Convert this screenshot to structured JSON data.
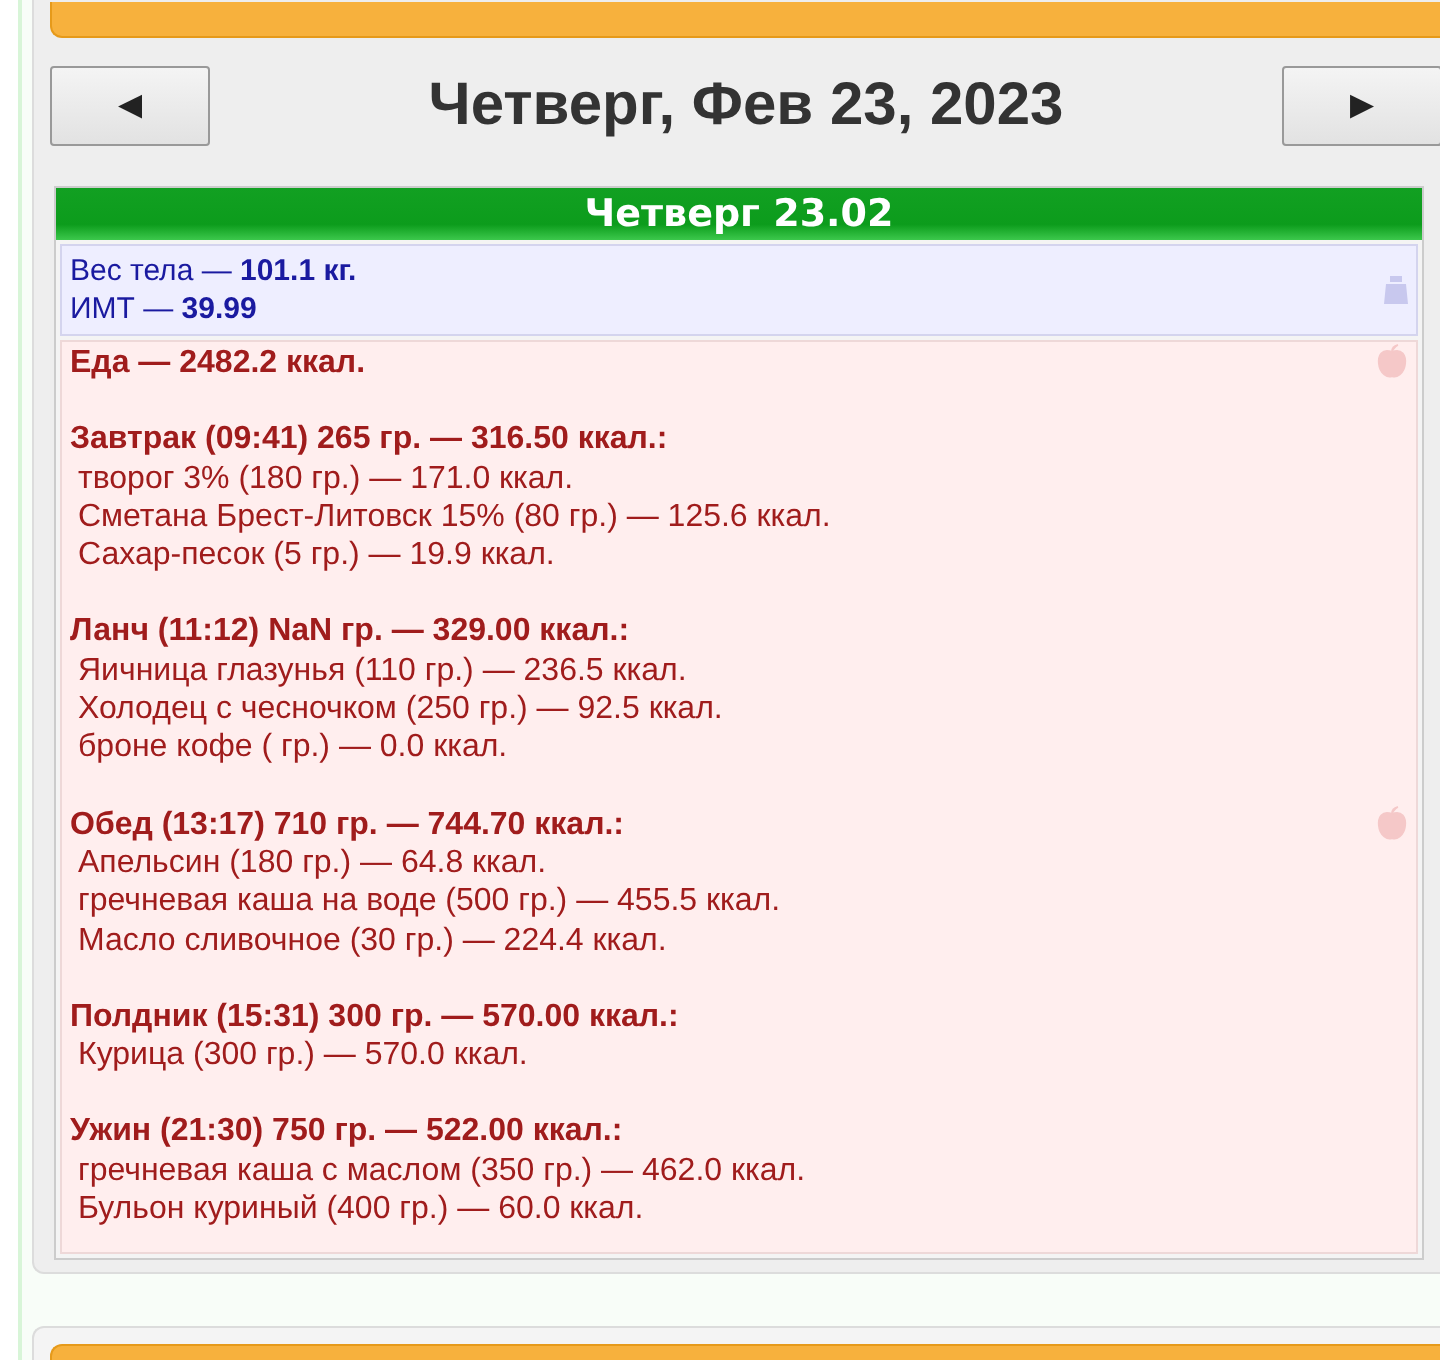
{
  "header": {
    "prev_button": "◄",
    "title": "Четверг, Фев 23, 2023",
    "next_button": "►"
  },
  "day": {
    "title": "Четверг 23.02",
    "weight": {
      "lines": [
        "Вес тела — **101.1 кг.**",
        "ИМТ — **39.99**"
      ]
    },
    "food": {
      "total": "Еда — 2482.2 ккал.",
      "meals": [
        {
          "title": "Завтрак (09:41) 265 гр. — 316.50 ккал.:",
          "marked": false,
          "items": [
            "творог 3% (180 гр.) — 171.0 ккал.",
            "Сметана Брест-Литовск 15% (80 гр.) — 125.6 ккал.",
            "Сахар-песок (5 гр.) — 19.9 ккал."
          ]
        },
        {
          "title": "Ланч (11:12) NaN гр. — 329.00 ккал.:",
          "marked": false,
          "items": [
            "Яичница глазунья (110 гр.) — 236.5 ккал.",
            "Холодец с чесночком (250 гр.) — 92.5 ккал.",
            "броне кофе ( гр.) — 0.0 ккал."
          ]
        },
        {
          "title": "Обед (13:17) 710 гр. — 744.70 ккал.:",
          "marked": true,
          "items": [
            "Апельсин (180 гр.) — 64.8 ккал.",
            "гречневая каша на воде (500 гр.) — 455.5 ккал.",
            "Масло сливочное (30 гр.) — 224.4 ккал."
          ]
        },
        {
          "title": "Полдник (15:31) 300 гр. — 570.00 ккал.:",
          "marked": false,
          "items": [
            "Курица (300 гр.) — 570.0 ккал."
          ]
        },
        {
          "title": "Ужин (21:30) 750 гр. — 522.00 ккал.:",
          "marked": false,
          "items": [
            "гречневая каша с маслом (350 гр.) — 462.0 ккал.",
            "Бульон куриный (400 гр.) — 60.0 ккал."
          ]
        }
      ]
    }
  }
}
